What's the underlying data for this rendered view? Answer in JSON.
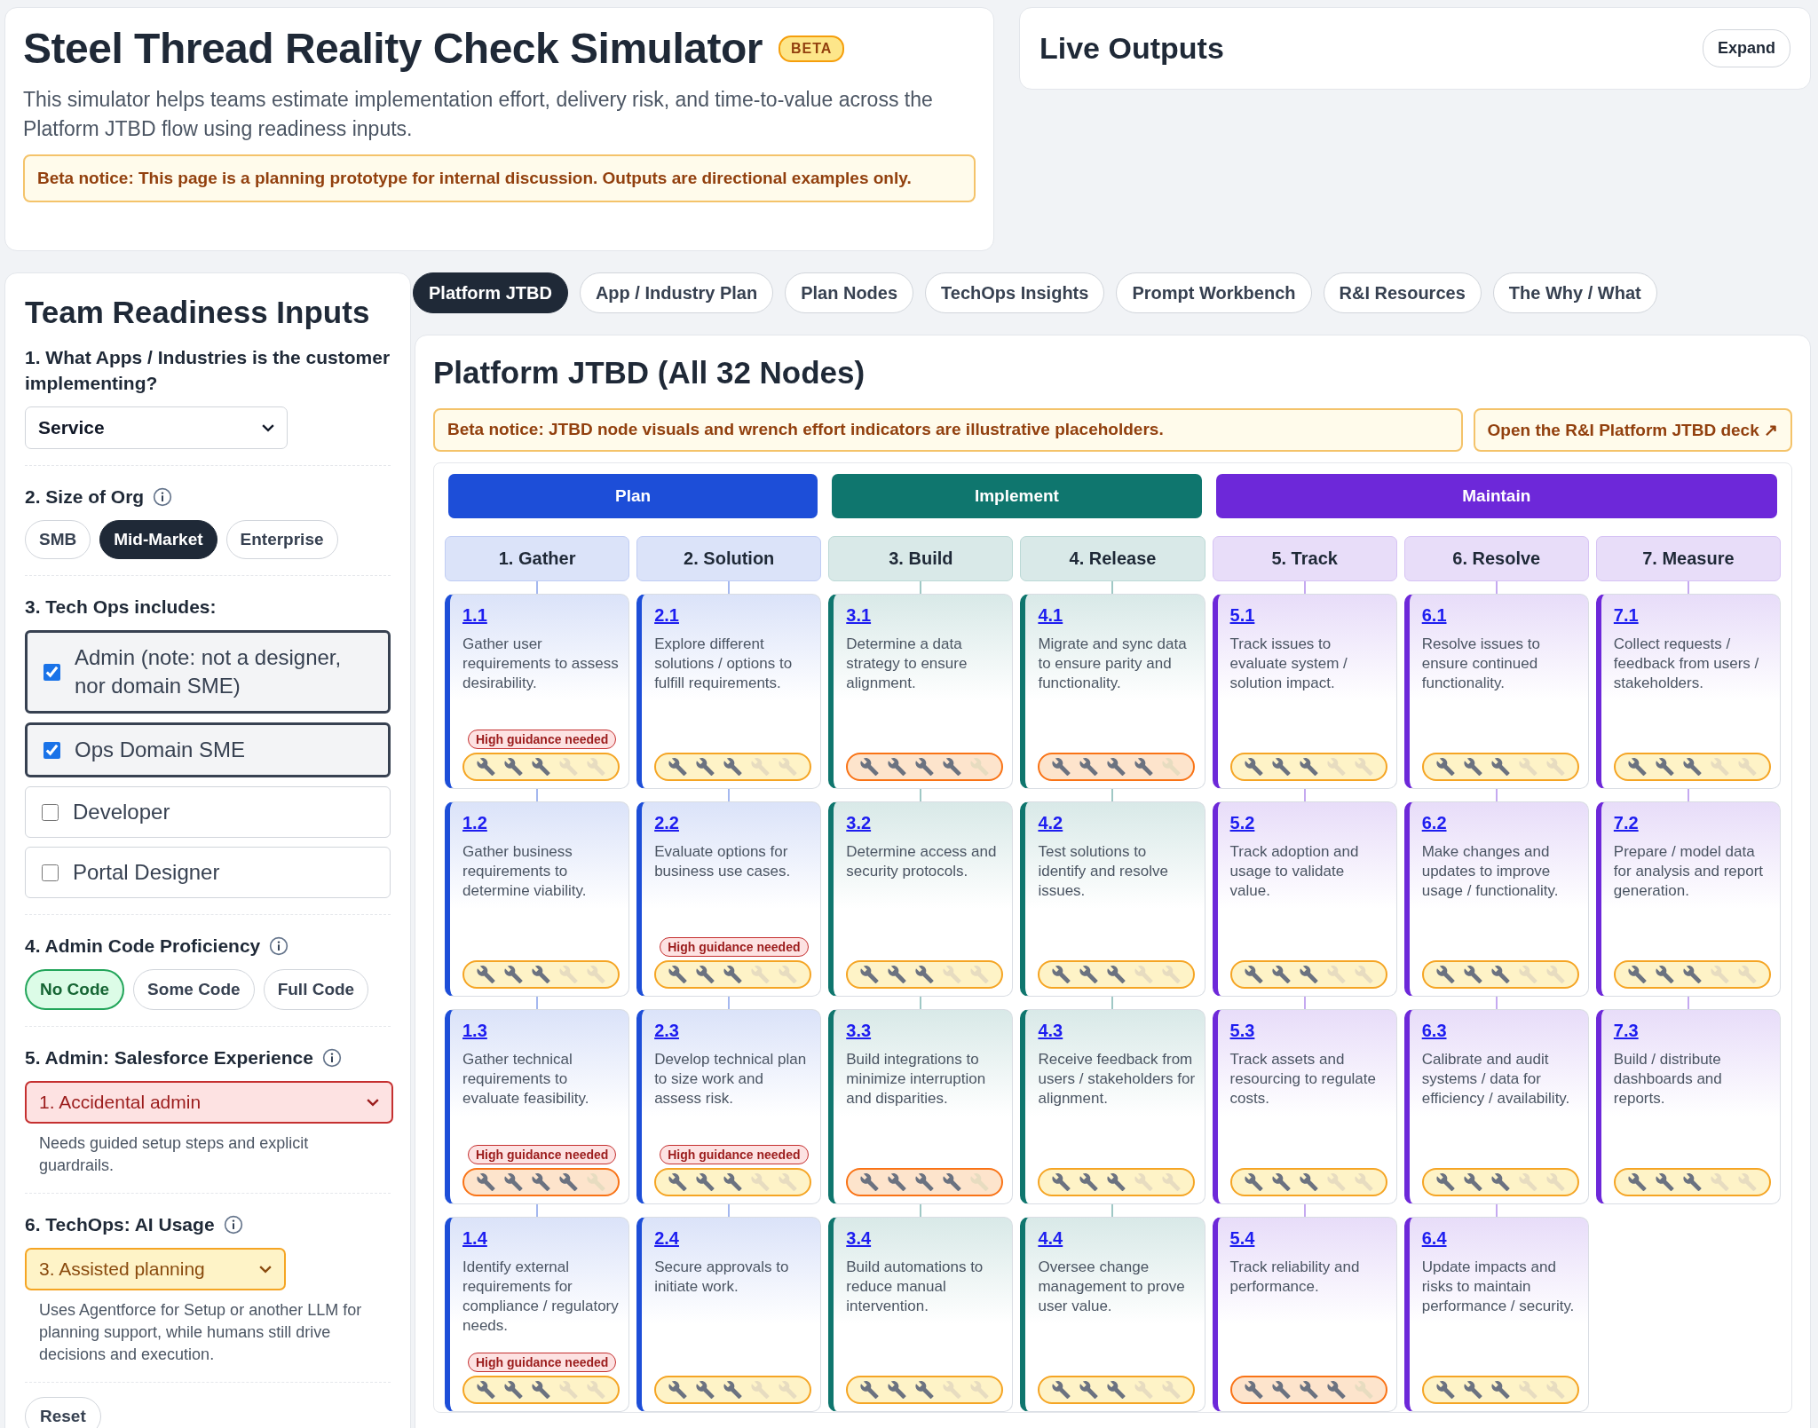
{
  "header": {
    "title": "Steel Thread Reality Check Simulator",
    "badge": "BETA",
    "description": "This simulator helps teams estimate implementation effort, delivery risk, and time-to-value across the Platform JTBD flow using readiness inputs.",
    "notice": "Beta notice: This page is a planning prototype for internal discussion. Outputs are directional examples only."
  },
  "live_outputs": {
    "title": "Live Outputs",
    "button": "Expand"
  },
  "inputs": {
    "title": "Team Readiness Inputs",
    "sections": [
      {
        "kind": "select",
        "label": "1. What Apps / Industries is the customer implementing?",
        "dropdown": {
          "kind": "plain",
          "value": "Service"
        }
      },
      {
        "kind": "pills",
        "label": "2. Size of Org",
        "info": true,
        "pills": {
          "kind": "dark",
          "options": [
            {
              "label": "SMB",
              "selected": false
            },
            {
              "label": "Mid-Market",
              "selected": true
            },
            {
              "label": "Enterprise",
              "selected": false
            }
          ]
        }
      },
      {
        "kind": "checks",
        "label": "3. Tech Ops includes:",
        "options": [
          {
            "label": "Admin (note: not a designer, nor domain SME)",
            "checked": true
          },
          {
            "label": "Ops Domain SME",
            "checked": true
          },
          {
            "label": "Developer",
            "checked": false
          },
          {
            "label": "Portal Designer",
            "checked": false
          }
        ]
      },
      {
        "kind": "pills",
        "label": "4. Admin Code Proficiency",
        "info": true,
        "pills": {
          "kind": "good",
          "options": [
            {
              "label": "No Code",
              "selected": true
            },
            {
              "label": "Some Code",
              "selected": false
            },
            {
              "label": "Full Code",
              "selected": false
            }
          ]
        }
      },
      {
        "kind": "select",
        "label": "5. Admin: Salesforce Experience",
        "info": true,
        "dropdown": {
          "kind": "danger",
          "value": "1. Accidental admin"
        },
        "note": "Needs guided setup steps and explicit guardrails."
      },
      {
        "kind": "select",
        "label": "6. TechOps: AI Usage",
        "info": true,
        "dropdown": {
          "kind": "warning",
          "value": "3. Assisted planning"
        },
        "note": "Uses Agentforce for Setup or another LLM for planning support, while humans still drive decisions and execution."
      }
    ],
    "reset": "Reset"
  },
  "tabs": [
    {
      "label": "Platform JTBD",
      "selected": true
    },
    {
      "label": "App / Industry Plan",
      "selected": false
    },
    {
      "label": "Plan Nodes",
      "selected": false
    },
    {
      "label": "TechOps Insights",
      "selected": false
    },
    {
      "label": "Prompt Workbench",
      "selected": false
    },
    {
      "label": "R&I Resources",
      "selected": false
    },
    {
      "label": "The Why / What",
      "selected": false
    }
  ],
  "board": {
    "title": "Platform JTBD (All 32 Nodes)",
    "notice": "Beta notice: JTBD node visuals and wrench effort indicators are illustrative placeholders.",
    "deck_link": "Open the R&I Platform JTBD deck ↗",
    "phases": [
      {
        "label": "Plan",
        "color": "#1d4ed8",
        "steps": [
          {
            "label": "1. Gather",
            "nodes": [
              {
                "id": "1.1",
                "text": "Gather user requirements to assess desirability.",
                "badge": "High guidance needed",
                "stars": 3
              },
              {
                "id": "1.2",
                "text": "Gather business requirements to determine viability.",
                "stars": 3
              },
              {
                "id": "1.3",
                "text": "Gather technical requirements to evaluate feasibility.",
                "badge": "High guidance needed",
                "stars": 4
              },
              {
                "id": "1.4",
                "text": "Identify external requirements for compliance / regulatory needs.",
                "badge": "High guidance needed",
                "stars": 3
              }
            ]
          },
          {
            "label": "2. Solution",
            "nodes": [
              {
                "id": "2.1",
                "text": "Explore different solutions / options to fulfill requirements.",
                "stars": 3
              },
              {
                "id": "2.2",
                "text": "Evaluate options for business use cases.",
                "badge": "High guidance needed",
                "stars": 3
              },
              {
                "id": "2.3",
                "text": "Develop technical plan to size work and assess risk.",
                "badge": "High guidance needed",
                "stars": 3
              },
              {
                "id": "2.4",
                "text": "Secure approvals to initiate work.",
                "stars": 3
              }
            ]
          }
        ]
      },
      {
        "label": "Implement",
        "color": "#0f766e",
        "steps": [
          {
            "label": "3. Build",
            "nodes": [
              {
                "id": "3.1",
                "text": "Determine a data strategy to ensure alignment.",
                "stars": 4
              },
              {
                "id": "3.2",
                "text": "Determine access and security protocols.",
                "stars": 3
              },
              {
                "id": "3.3",
                "text": "Build integrations to minimize interruption and disparities.",
                "stars": 4
              },
              {
                "id": "3.4",
                "text": "Build automations to reduce manual intervention.",
                "stars": 3
              }
            ]
          },
          {
            "label": "4. Release",
            "nodes": [
              {
                "id": "4.1",
                "text": "Migrate and sync data to ensure parity and functionality.",
                "stars": 4
              },
              {
                "id": "4.2",
                "text": "Test solutions to identify and resolve issues.",
                "stars": 3
              },
              {
                "id": "4.3",
                "text": "Receive feedback from users / stakeholders for alignment.",
                "stars": 3
              },
              {
                "id": "4.4",
                "text": "Oversee change management to prove user value.",
                "stars": 3
              }
            ]
          }
        ]
      },
      {
        "label": "Maintain",
        "color": "#6d28d9",
        "steps": [
          {
            "label": "5. Track",
            "nodes": [
              {
                "id": "5.1",
                "text": "Track issues to evaluate system / solution impact.",
                "stars": 3
              },
              {
                "id": "5.2",
                "text": "Track adoption and usage to validate value.",
                "stars": 3
              },
              {
                "id": "5.3",
                "text": "Track assets and resourcing to regulate costs.",
                "stars": 3
              },
              {
                "id": "5.4",
                "text": "Track reliability and performance.",
                "stars": 4
              }
            ]
          },
          {
            "label": "6. Resolve",
            "nodes": [
              {
                "id": "6.1",
                "text": "Resolve issues to ensure continued functionality.",
                "stars": 3
              },
              {
                "id": "6.2",
                "text": "Make changes and updates to improve usage / functionality.",
                "stars": 3
              },
              {
                "id": "6.3",
                "text": "Calibrate and audit systems / data for efficiency / availability.",
                "stars": 3
              },
              {
                "id": "6.4",
                "text": "Update impacts and risks to maintain performance / security.",
                "stars": 3
              }
            ]
          },
          {
            "label": "7. Measure",
            "nodes": [
              {
                "id": "7.1",
                "text": "Collect requests / feedback from users / stakeholders.",
                "stars": 3
              },
              {
                "id": "7.2",
                "text": "Prepare / model data for analysis and report generation.",
                "stars": 3
              },
              {
                "id": "7.3",
                "text": "Build / distribute dashboards and reports.",
                "stars": 3
              }
            ]
          }
        ]
      }
    ]
  }
}
